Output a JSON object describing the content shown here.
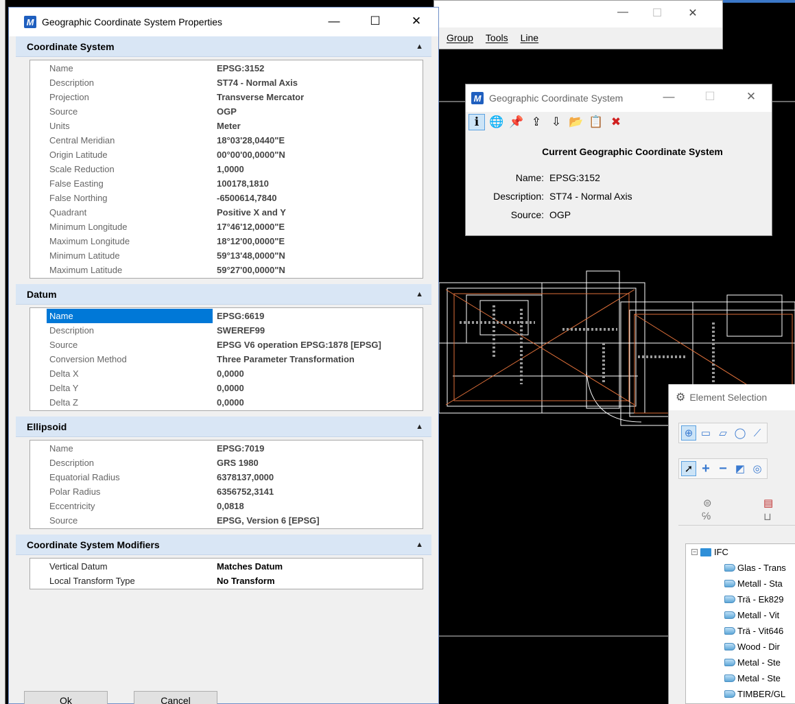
{
  "main_window": {
    "menu": [
      "Group",
      "Tools",
      "Line"
    ],
    "controls": {
      "minimize": "—",
      "maximize": "☐",
      "close": "✕"
    }
  },
  "properties_dialog": {
    "title": "Geographic Coordinate System Properties",
    "controls": {
      "minimize": "—",
      "maximize": "☐",
      "close": "✕"
    },
    "coordinate_system": {
      "header": "Coordinate System",
      "rows": [
        {
          "key": "Name",
          "value": "EPSG:3152"
        },
        {
          "key": "Description",
          "value": "ST74 - Normal Axis"
        },
        {
          "key": "Projection",
          "value": "Transverse Mercator"
        },
        {
          "key": "Source",
          "value": "OGP"
        },
        {
          "key": "Units",
          "value": "Meter"
        },
        {
          "key": "Central Meridian",
          "value": "18°03'28,0440\"E"
        },
        {
          "key": "Origin Latitude",
          "value": "00°00'00,0000\"N"
        },
        {
          "key": "Scale Reduction",
          "value": "1,0000"
        },
        {
          "key": "False Easting",
          "value": "100178,1810"
        },
        {
          "key": "False Northing",
          "value": "-6500614,7840"
        },
        {
          "key": "Quadrant",
          "value": "Positive X and Y"
        },
        {
          "key": "Minimum Longitude",
          "value": "17°46'12,0000\"E"
        },
        {
          "key": "Maximum Longitude",
          "value": "18°12'00,0000\"E"
        },
        {
          "key": "Minimum Latitude",
          "value": "59°13'48,0000\"N"
        },
        {
          "key": "Maximum Latitude",
          "value": "59°27'00,0000\"N"
        }
      ]
    },
    "datum": {
      "header": "Datum",
      "rows": [
        {
          "key": "Name",
          "value": "EPSG:6619"
        },
        {
          "key": "Description",
          "value": "SWEREF99"
        },
        {
          "key": "Source",
          "value": "EPSG V6 operation EPSG:1878 [EPSG]"
        },
        {
          "key": "Conversion Method",
          "value": "Three Parameter Transformation"
        },
        {
          "key": "Delta X",
          "value": "0,0000"
        },
        {
          "key": "Delta Y",
          "value": "0,0000"
        },
        {
          "key": "Delta Z",
          "value": "0,0000"
        }
      ]
    },
    "ellipsoid": {
      "header": "Ellipsoid",
      "rows": [
        {
          "key": "Name",
          "value": "EPSG:7019"
        },
        {
          "key": "Description",
          "value": "GRS 1980"
        },
        {
          "key": "Equatorial Radius",
          "value": "6378137,0000"
        },
        {
          "key": "Polar Radius",
          "value": "6356752,3141"
        },
        {
          "key": "Eccentricity",
          "value": "0,0818"
        },
        {
          "key": "Source",
          "value": "EPSG, Version 6 [EPSG]"
        }
      ]
    },
    "modifiers": {
      "header": "Coordinate System Modifiers",
      "rows": [
        {
          "key": "Vertical Datum",
          "value": "Matches Datum"
        },
        {
          "key": "Local Transform Type",
          "value": "No Transform"
        }
      ]
    },
    "ok_label": "Ok",
    "cancel_label": "Cancel"
  },
  "gcs_window": {
    "title": "Geographic Coordinate System",
    "controls": {
      "minimize": "—",
      "maximize": "☐",
      "close": "✕"
    },
    "heading": "Current Geographic Coordinate System",
    "name_label": "Name:",
    "name_value": "EPSG:3152",
    "description_label": "Description:",
    "description_value": "ST74 - Normal Axis",
    "source_label": "Source:",
    "source_value": "OGP"
  },
  "element_selection": {
    "title": "Element Selection",
    "tree_root": "IFC",
    "tree_items": [
      "Glas - Trans",
      "Metall - Sta",
      "Trä - Ek829",
      "Metall - Vit",
      "Trä - Vit646",
      "Wood - Dir",
      "Metal - Ste",
      "Metal - Ste",
      "TIMBER/GL"
    ]
  },
  "colors": {
    "accent": "#0078d7",
    "section_header": "#d9e6f5",
    "cad_background": "#000000",
    "cad_lines": "#ffffff",
    "cad_orange": "#e0703a"
  }
}
